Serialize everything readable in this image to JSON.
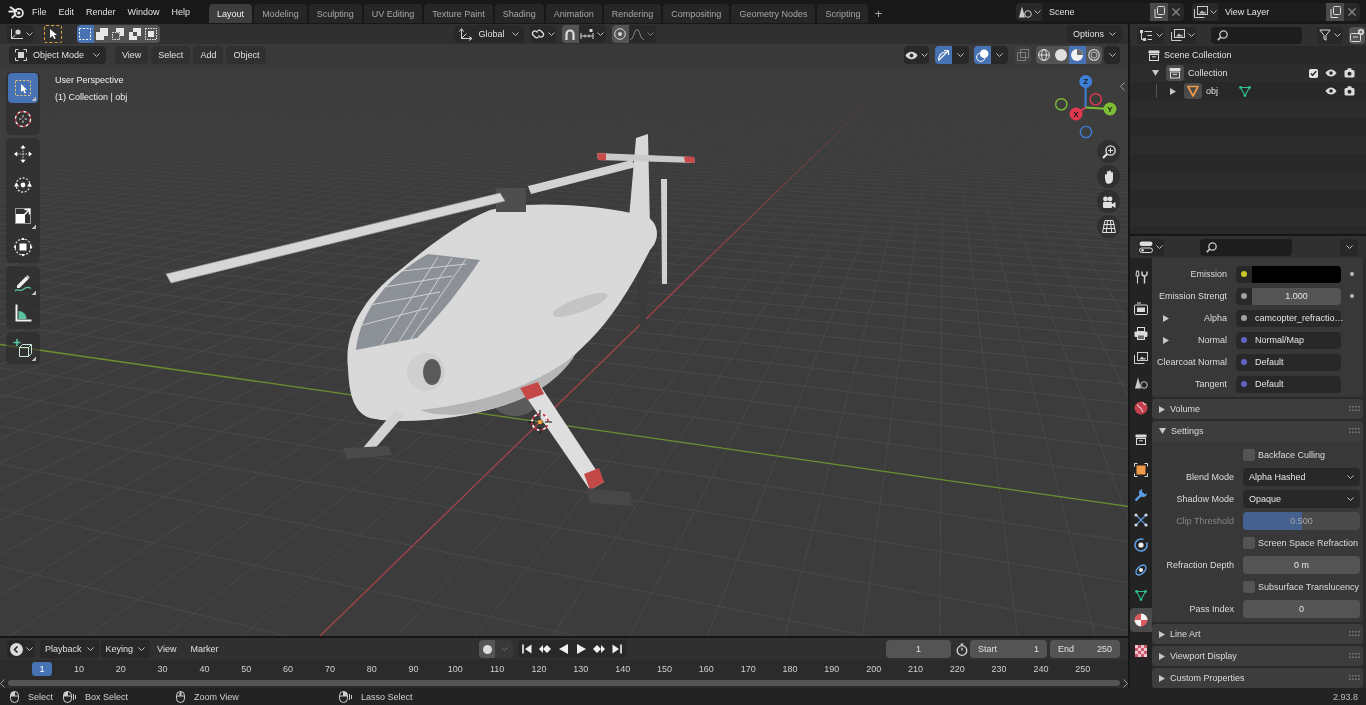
{
  "top_bar": {
    "menus": [
      "File",
      "Edit",
      "Render",
      "Window",
      "Help"
    ],
    "workspaces": [
      {
        "label": "Layout",
        "selected": true
      },
      {
        "label": "Modeling",
        "selected": false
      },
      {
        "label": "Sculpting",
        "selected": false
      },
      {
        "label": "UV Editing",
        "selected": false
      },
      {
        "label": "Texture Paint",
        "selected": false
      },
      {
        "label": "Shading",
        "selected": false
      },
      {
        "label": "Animation",
        "selected": false
      },
      {
        "label": "Rendering",
        "selected": false
      },
      {
        "label": "Compositing",
        "selected": false
      },
      {
        "label": "Geometry Nodes",
        "selected": false
      },
      {
        "label": "Scripting",
        "selected": false
      }
    ],
    "add_workspace": "+",
    "scene": "Scene",
    "view_layer": "View Layer"
  },
  "viewport": {
    "tool_header": {
      "select_modes": [
        {
          "selected": true
        },
        {
          "selected": false
        },
        {
          "selected": false
        },
        {
          "selected": false
        },
        {
          "selected": false
        }
      ],
      "transform_orientation": "Global",
      "snap": false,
      "proportional_editing": false,
      "options": "Options"
    },
    "header": {
      "mode": "Object Mode",
      "menus": [
        "View",
        "Select",
        "Add",
        "Object"
      ],
      "gizmos": true,
      "overlays": true,
      "xray": false,
      "shading_modes": [
        {
          "selected": false
        },
        {
          "selected": false
        },
        {
          "selected": true
        },
        {
          "selected": false
        }
      ]
    },
    "info": [
      "User Perspective",
      "(1) Collection | obj"
    ],
    "tools": [
      [
        {
          "kind": "select_box",
          "selected": true,
          "variants": true
        },
        {
          "kind": "cursor",
          "selected": false,
          "variants": false
        }
      ],
      [
        {
          "kind": "move",
          "selected": false,
          "variants": false
        },
        {
          "kind": "rotate",
          "selected": false,
          "variants": false
        },
        {
          "kind": "scale",
          "selected": false,
          "variants": true
        },
        {
          "kind": "transform",
          "selected": false,
          "variants": false
        }
      ],
      [
        {
          "kind": "annotate",
          "selected": false,
          "variants": true
        },
        {
          "kind": "measure",
          "selected": false,
          "variants": false
        }
      ],
      [
        {
          "kind": "add_cube",
          "selected": false,
          "variants": true
        }
      ]
    ],
    "axes": [
      "Z",
      "Y",
      "X"
    ]
  },
  "outliner": {
    "tree": [
      {
        "kind": "scene_collection",
        "label": "Scene Collection",
        "selected": false,
        "children": [
          {
            "kind": "collection",
            "label": "Collection",
            "selected": false,
            "expanded": true,
            "checked": true,
            "children": [
              {
                "kind": "object",
                "label": "obj",
                "selected": false,
                "expanded": false
              }
            ]
          }
        ]
      }
    ]
  },
  "properties": {
    "tabs": [
      [
        {
          "kind": "tool",
          "selected": false
        }
      ],
      [
        {
          "kind": "render",
          "selected": false
        },
        {
          "kind": "output",
          "selected": false
        },
        {
          "kind": "view_layer",
          "selected": false
        },
        {
          "kind": "scene",
          "selected": false
        },
        {
          "kind": "world",
          "selected": false
        }
      ],
      [
        {
          "kind": "collection",
          "selected": false
        }
      ],
      [
        {
          "kind": "object",
          "selected": false
        },
        {
          "kind": "modifiers",
          "selected": false
        },
        {
          "kind": "particles",
          "selected": false
        },
        {
          "kind": "physics",
          "selected": false
        },
        {
          "kind": "constraints",
          "selected": false
        },
        {
          "kind": "data",
          "selected": false
        },
        {
          "kind": "material",
          "selected": true
        }
      ],
      [
        {
          "kind": "texture",
          "selected": false
        }
      ]
    ],
    "inputs": [
      {
        "kind": "color",
        "label": "Emission",
        "color": "#c7c729",
        "swatch": {
          "color": "#000000"
        }
      },
      {
        "kind": "number",
        "label": "Emission Strengt",
        "color": "#a1a1a1",
        "value": "1.000"
      },
      {
        "kind": "linked",
        "label": "Alpha",
        "color": "#a1a1a1",
        "value": "camcopter_refractio…",
        "expanded": false
      },
      {
        "kind": "linked",
        "label": "Normal",
        "color": "#6363c7",
        "value": "Normal/Map",
        "expanded": false
      },
      {
        "kind": "default",
        "label": "Clearcoat Normal",
        "color": "#6363c7",
        "value": "Default"
      },
      {
        "kind": "default",
        "label": "Tangent",
        "color": "#6363c7",
        "value": "Default"
      }
    ],
    "panels": [
      {
        "label": "Volume",
        "expanded": false
      },
      {
        "label": "Settings",
        "expanded": true,
        "rows": [
          {
            "kind": "checkbox",
            "label": "Backface Culling",
            "checked": false
          },
          {
            "kind": "dropdown",
            "label": "Blend Mode",
            "value": "Alpha Hashed"
          },
          {
            "kind": "dropdown",
            "label": "Shadow Mode",
            "value": "Opaque"
          },
          {
            "kind": "slider",
            "label": "Clip Threshold",
            "value": "0.500",
            "level": 0.5,
            "disabled": true
          },
          {
            "kind": "checkbox",
            "label": "Screen Space Refraction",
            "checked": false
          },
          {
            "kind": "number",
            "label": "Refraction Depth",
            "value": "0 m"
          },
          {
            "kind": "checkbox",
            "label": "Subsurface Translucency",
            "checked": false
          },
          {
            "kind": "number",
            "label": "Pass Index",
            "value": "0"
          }
        ]
      },
      {
        "label": "Line Art",
        "expanded": false
      },
      {
        "label": "Viewport Display",
        "expanded": false
      },
      {
        "label": "Custom Properties",
        "expanded": false
      }
    ]
  },
  "timeline": {
    "dropdowns": [
      "Playback",
      "Keying"
    ],
    "menus": [
      "View",
      "Marker"
    ],
    "auto_keying": false,
    "current_frame": "1",
    "start_label": "Start",
    "start": "1",
    "end_label": "End",
    "end": "250",
    "playhead": "1",
    "frame_labels": [
      "10",
      "20",
      "30",
      "40",
      "50",
      "60",
      "70",
      "80",
      "90",
      "100",
      "110",
      "120",
      "130",
      "140",
      "150",
      "160",
      "170",
      "180",
      "190",
      "200",
      "210",
      "220",
      "230",
      "240",
      "250"
    ]
  },
  "status_bar": {
    "hints": [
      {
        "kind": "left",
        "label": "Select"
      },
      {
        "kind": "left_drag",
        "label": "Box Select"
      },
      {
        "kind": "middle",
        "label": "Zoom View"
      },
      {
        "kind": "right_drag",
        "label": "Lasso Select"
      }
    ],
    "version": "2.93.8"
  }
}
